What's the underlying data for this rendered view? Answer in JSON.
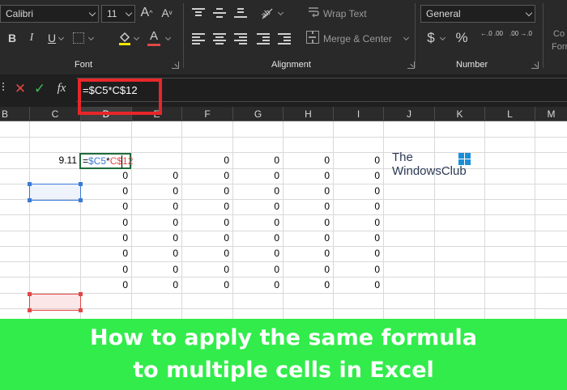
{
  "ribbon": {
    "font_group": {
      "label": "Font",
      "font_name": "Calibri",
      "font_size": "11",
      "increase_font_glyph": "A",
      "decrease_font_glyph": "A",
      "bold_glyph": "B",
      "italic_glyph": "I",
      "underline_glyph": "U",
      "font_color_glyph": "A"
    },
    "alignment_group": {
      "label": "Alignment",
      "wrap_text": "Wrap Text",
      "merge_center": "Merge & Center"
    },
    "number_group": {
      "label": "Number",
      "format": "General",
      "currency_glyph": "$",
      "percent_glyph": "%",
      "increase_decimal_glyph": "←.0 .00",
      "decrease_decimal_glyph": ".00 →.0"
    },
    "styles_group_partial": {
      "line1": "Co",
      "line2": "Forr"
    }
  },
  "formula_bar": {
    "cancel_glyph": "✕",
    "enter_glyph": "✓",
    "fx_label": "fx",
    "formula": "=$C5*C$12"
  },
  "columns": [
    "B",
    "C",
    "D",
    "E",
    "F",
    "G",
    "H",
    "I",
    "J",
    "K",
    "L",
    "M"
  ],
  "selected_column": "D",
  "cells": {
    "c5": "9.11",
    "active_formula": {
      "part1": "=",
      "part2": "$C5",
      "part3": "*",
      "part4": "C$12"
    },
    "row5": [
      "0",
      "0",
      "0",
      "0",
      "0"
    ],
    "rows": [
      [
        "0",
        "0",
        "0",
        "0",
        "0",
        "0"
      ],
      [
        "0",
        "0",
        "0",
        "0",
        "0",
        "0"
      ],
      [
        "0",
        "0",
        "0",
        "0",
        "0",
        "0"
      ],
      [
        "0",
        "0",
        "0",
        "0",
        "0",
        "0"
      ],
      [
        "0",
        "0",
        "0",
        "0",
        "0",
        "0"
      ],
      [
        "0",
        "0",
        "0",
        "0",
        "0",
        "0"
      ],
      [
        "0",
        "0",
        "0",
        "0",
        "0",
        "0"
      ],
      [
        "0",
        "0",
        "0",
        "0",
        "0",
        "0"
      ]
    ]
  },
  "watermark": {
    "line1": "The",
    "line2": "WindowsClub"
  },
  "banner": {
    "line1": "How to apply the same formula",
    "line2": "to multiple cells in Excel"
  },
  "colors": {
    "banner": "#32ec4b",
    "highlight_box": "#e8262a",
    "ref_blue": "#3a7bd5",
    "ref_red": "#e04848",
    "active_border": "#1e6b3c"
  }
}
